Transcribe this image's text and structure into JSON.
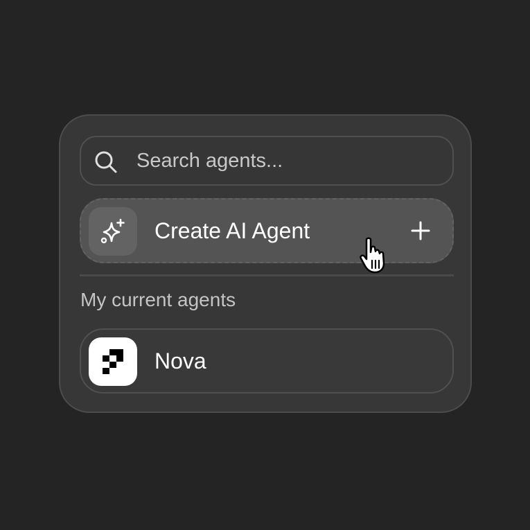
{
  "search": {
    "placeholder": "Search agents...",
    "icon": "search-icon"
  },
  "create": {
    "label": "Create AI Agent",
    "icon": "sparkles-icon",
    "action_icon": "plus-icon"
  },
  "agents_section": {
    "title": "My current agents",
    "items": [
      {
        "name": "Nova",
        "icon": "pixel-logo-icon"
      }
    ]
  },
  "colors": {
    "background": "#242424",
    "panel": "#373737",
    "highlight": "#545454",
    "text": "#ffffff",
    "muted_text": "#c4c4c4"
  }
}
